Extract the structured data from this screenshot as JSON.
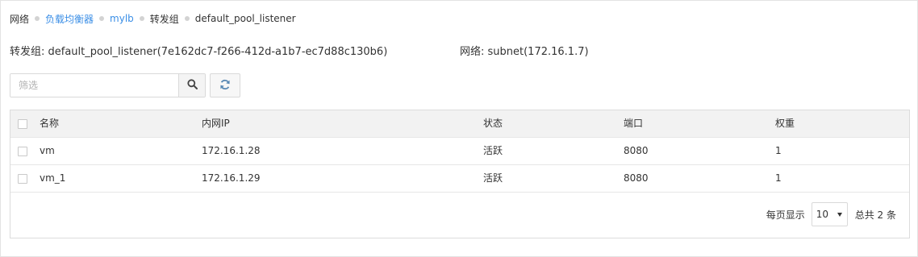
{
  "breadcrumb": [
    {
      "label": "网络",
      "link": false
    },
    {
      "label": "负载均衡器",
      "link": true
    },
    {
      "label": "mylb",
      "link": true
    },
    {
      "label": "转发组",
      "link": false
    },
    {
      "label": "default_pool_listener",
      "link": false
    }
  ],
  "info": {
    "pool_label": "转发组: ",
    "pool_value": "default_pool_listener(7e162dc7-f266-412d-a1b7-ec7d88c130b6)",
    "network_label": "网络: ",
    "network_value": "subnet(172.16.1.7)"
  },
  "toolbar": {
    "search_placeholder": "筛选",
    "search_icon": "search-icon",
    "refresh_icon": "refresh-icon"
  },
  "table": {
    "columns": [
      "名称",
      "内网IP",
      "状态",
      "端口",
      "权重"
    ],
    "rows": [
      {
        "name": "vm",
        "ip": "172.16.1.28",
        "status": "活跃",
        "port": "8080",
        "weight": "1"
      },
      {
        "name": "vm_1",
        "ip": "172.16.1.29",
        "status": "活跃",
        "port": "8080",
        "weight": "1"
      }
    ]
  },
  "pager": {
    "per_page_label": "每页显示",
    "per_page_value": "10",
    "total_label": "总共 2 条"
  },
  "colors": {
    "link": "#3a8ee6",
    "header_bg": "#f2f2f2",
    "border": "#dcdcdc"
  }
}
